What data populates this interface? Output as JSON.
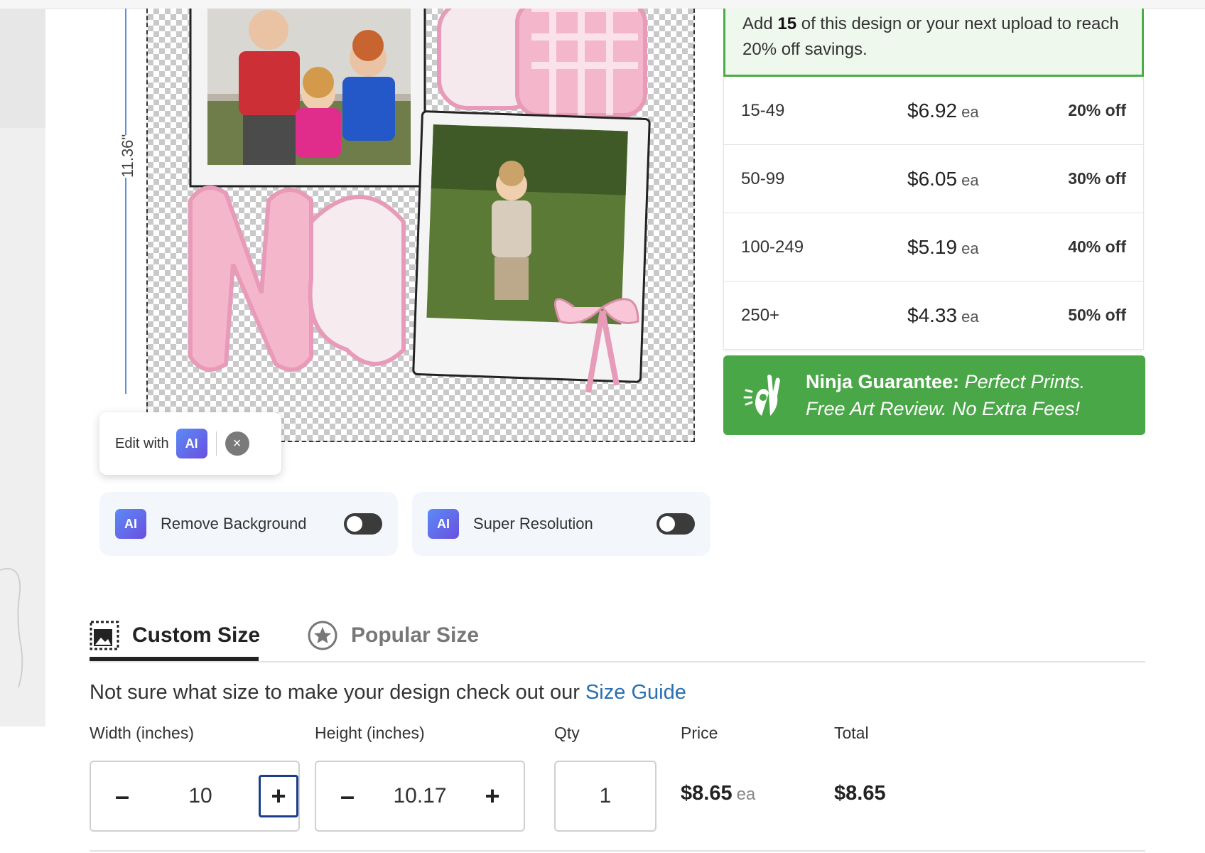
{
  "ruler": {
    "height_label": "11.36\""
  },
  "edit_ai": {
    "label": "Edit with",
    "badge": "AI",
    "close": "×"
  },
  "ai_tools": [
    {
      "badge": "AI",
      "label": "Remove Background",
      "enabled": false
    },
    {
      "badge": "AI",
      "label": "Super Resolution",
      "enabled": false
    }
  ],
  "promo": {
    "prefix": "Add ",
    "qty": "15",
    "suffix": " of this design or your next upload to reach 20% off savings."
  },
  "tiers": [
    {
      "range": "15-49",
      "price": "$6.92",
      "unit": "ea",
      "discount": "20% off"
    },
    {
      "range": "50-99",
      "price": "$6.05",
      "unit": "ea",
      "discount": "30% off"
    },
    {
      "range": "100-249",
      "price": "$5.19",
      "unit": "ea",
      "discount": "40% off"
    },
    {
      "range": "250+",
      "price": "$4.33",
      "unit": "ea",
      "discount": "50% off"
    }
  ],
  "guarantee": {
    "title": "Ninja Guarantee:",
    "line1": " Perfect Prints.",
    "line2": "Free Art Review. No Extra Fees!"
  },
  "size_tabs": {
    "custom": "Custom Size",
    "popular": "Popular Size",
    "active": "custom"
  },
  "hint": {
    "text": "Not sure what size to make your design check out our ",
    "link": "Size Guide"
  },
  "form": {
    "width_label": "Width (inches)",
    "height_label": "Height (inches)",
    "qty_label": "Qty",
    "price_label": "Price",
    "total_label": "Total",
    "width_value": "10",
    "height_value": "10.17",
    "qty_value": "1",
    "price_value": "$8.65",
    "price_unit": "ea",
    "total_value": "$8.65",
    "minus": "–",
    "plus": "+"
  },
  "colors": {
    "accent_green": "#4aa748",
    "link_blue": "#2a6fb0",
    "ai_gradient": "#5b8bf5"
  }
}
